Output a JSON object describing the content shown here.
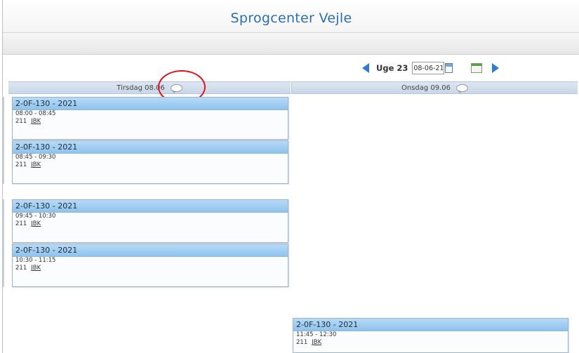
{
  "header": {
    "title": "Sprogcenter Vejle"
  },
  "week_nav": {
    "week_label": "Uge 23",
    "date_value": "08-06-21"
  },
  "days": [
    {
      "label": "Tirsdag 08.06"
    },
    {
      "label": "Onsdag 09.06"
    }
  ],
  "lessons": [
    {
      "title": "2-0F-130 - 2021",
      "time": "08:00 - 08:45",
      "room": "211",
      "teacher": "JBK"
    },
    {
      "title": "2-0F-130 - 2021",
      "time": "08:45 - 09:30",
      "room": "211",
      "teacher": "JBK"
    },
    {
      "title": "2-0F-130 - 2021",
      "time": "09:45 - 10:30",
      "room": "211",
      "teacher": "JBK"
    },
    {
      "title": "2-0F-130 - 2021",
      "time": "10:30 - 11:15",
      "room": "211",
      "teacher": "JBK"
    },
    {
      "title": "2-0F-130 - 2021",
      "time": "11:45 - 12:30",
      "room": "211",
      "teacher": "JBK"
    }
  ],
  "colors": {
    "accent": "#2f7ad6",
    "title": "#2a6fb3",
    "highlight_circle": "#e0131b"
  },
  "icons": [
    "arrow-left-icon",
    "calendar-icon",
    "schedule-icon",
    "arrow-right-icon",
    "comment-icon"
  ]
}
